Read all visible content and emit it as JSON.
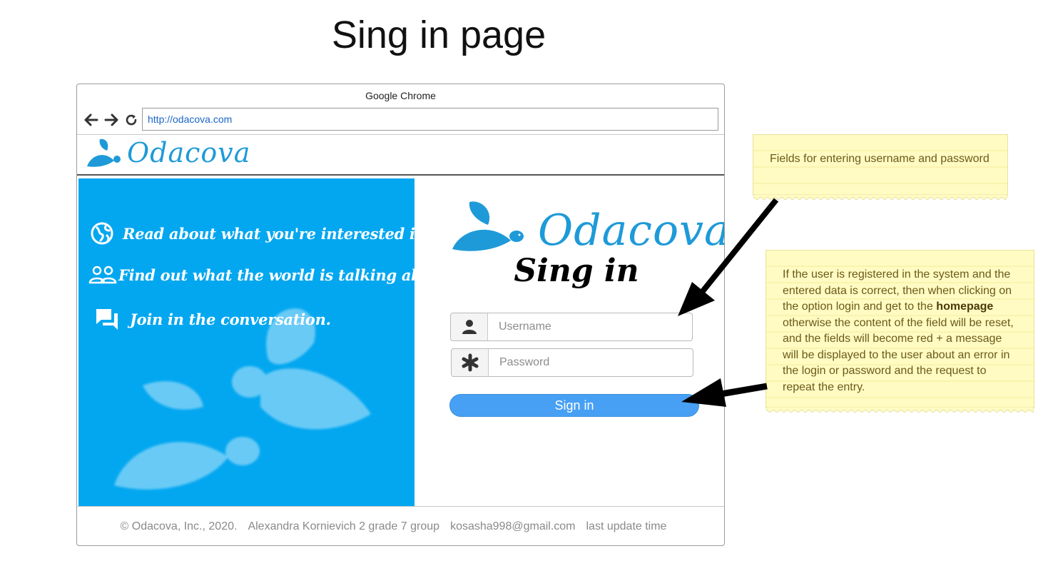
{
  "page": {
    "title": "Sing in page"
  },
  "browser": {
    "title": "Google Chrome",
    "url": "http://odacova.com",
    "nav_icons": [
      "back-arrow-icon",
      "forward-arrow-icon",
      "reload-icon"
    ]
  },
  "site": {
    "brand": "Odacova",
    "features": [
      {
        "icon": "globe-icon",
        "text": "Read about what you're interested in."
      },
      {
        "icon": "people-icon",
        "text": "Find out what the world is talking about."
      },
      {
        "icon": "chat-icon",
        "text": "Join in the conversation."
      }
    ],
    "signin_heading": "Sing in",
    "username_placeholder": "Username",
    "password_placeholder": "Password",
    "signin_button": "Sign in",
    "footer": {
      "copyright": "© Odacova, Inc., 2020.",
      "author": "Alexandra Kornievich 2 grade 7 group",
      "email": "kosasha998@gmail.com",
      "update": "last update time"
    }
  },
  "notes": {
    "note1": "Fields for entering username and password",
    "note2_before": "If the user is registered in the system and the entered data is correct, then when clicking on the option login and get to the",
    "note2_bold": "homepage",
    "note2_after": "otherwise the content of the field will be reset, and the fields will become red + a message will be displayed to the user about an error in the login or password and the request to repeat the entry."
  },
  "colors": {
    "accent_blue": "#03a7f0",
    "brand_blue": "#1e9ad8",
    "button_blue": "#47a0f4",
    "note_yellow": "#fffbc2"
  }
}
